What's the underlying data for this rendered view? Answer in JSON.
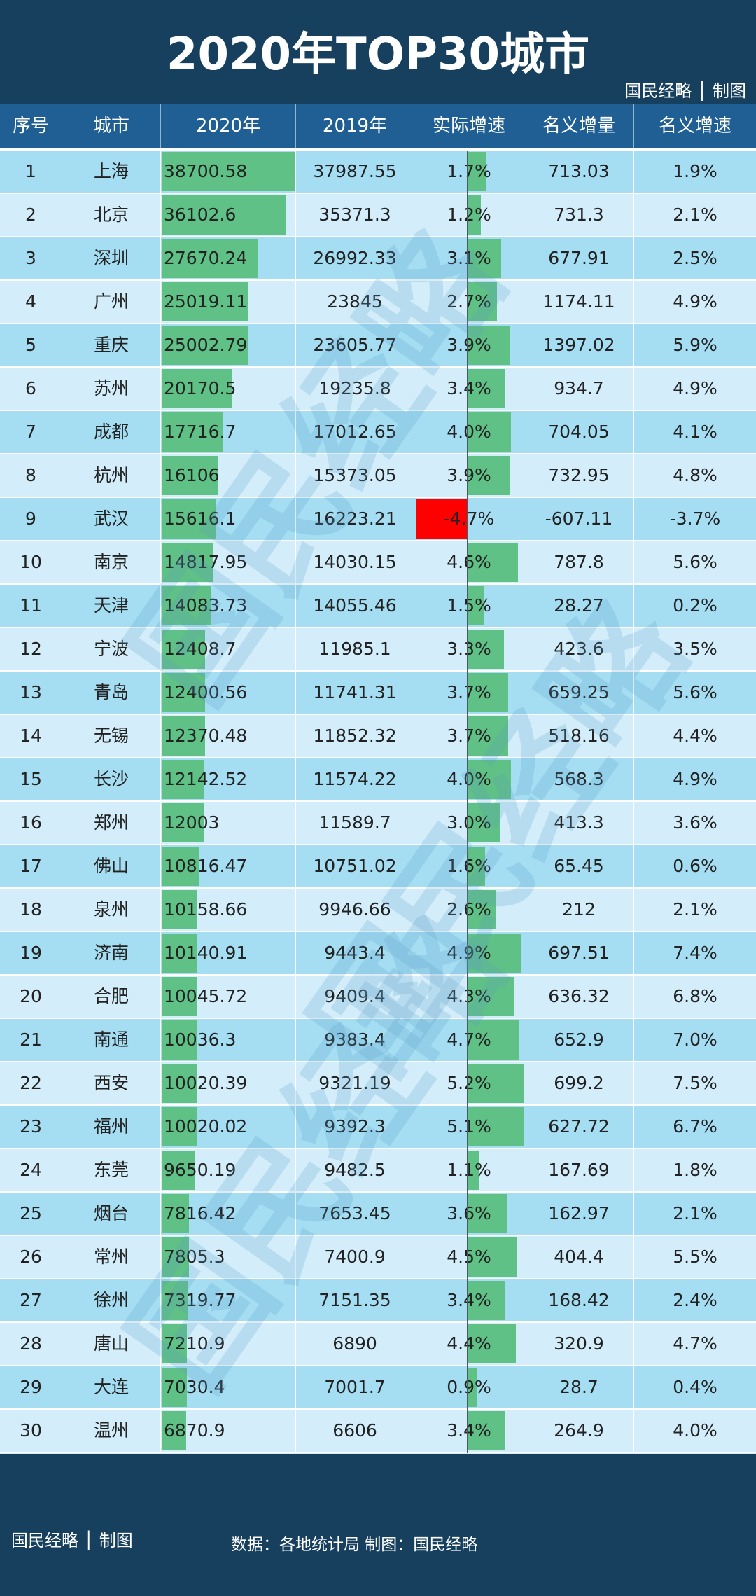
{
  "header": {
    "title": "2020年TOP30城市",
    "brand": "国民经略 │ 制图"
  },
  "columns": [
    "序号",
    "城市",
    "2020年",
    "2019年",
    "实际增速",
    "名义增量",
    "名义增速"
  ],
  "footer": {
    "brand": "国民经略 │ 制图",
    "source": "数据：各地统计局  制图：国民经略"
  },
  "watermark": "国民经略",
  "colors": {
    "title_bg": "#17405f",
    "header_bg": "#1f5f93",
    "row_odd": "#a5ddf2",
    "row_even": "#d3eefa",
    "bar_positive": "#5fc185",
    "bar_negative": "#ff0000"
  },
  "chart_data": {
    "type": "table",
    "title": "2020年TOP30城市",
    "columns": [
      "序号",
      "城市",
      "2020年",
      "2019年",
      "实际增速",
      "名义增量",
      "名义增速"
    ],
    "bar_columns": [
      "2020年",
      "实际增速"
    ],
    "rows": [
      {
        "rank": "1",
        "city": "上海",
        "y2020": "38700.58",
        "y2019": "37987.55",
        "real_growth": "1.7%",
        "nominal_increase": "713.03",
        "nominal_growth": "1.9%",
        "gdp": 38700.58,
        "rg": 1.7
      },
      {
        "rank": "2",
        "city": "北京",
        "y2020": "36102.6",
        "y2019": "35371.3",
        "real_growth": "1.2%",
        "nominal_increase": "731.3",
        "nominal_growth": "2.1%",
        "gdp": 36102.6,
        "rg": 1.2
      },
      {
        "rank": "3",
        "city": "深圳",
        "y2020": "27670.24",
        "y2019": "26992.33",
        "real_growth": "3.1%",
        "nominal_increase": "677.91",
        "nominal_growth": "2.5%",
        "gdp": 27670.24,
        "rg": 3.1
      },
      {
        "rank": "4",
        "city": "广州",
        "y2020": "25019.11",
        "y2019": "23845",
        "real_growth": "2.7%",
        "nominal_increase": "1174.11",
        "nominal_growth": "4.9%",
        "gdp": 25019.11,
        "rg": 2.7
      },
      {
        "rank": "5",
        "city": "重庆",
        "y2020": "25002.79",
        "y2019": "23605.77",
        "real_growth": "3.9%",
        "nominal_increase": "1397.02",
        "nominal_growth": "5.9%",
        "gdp": 25002.79,
        "rg": 3.9
      },
      {
        "rank": "6",
        "city": "苏州",
        "y2020": "20170.5",
        "y2019": "19235.8",
        "real_growth": "3.4%",
        "nominal_increase": "934.7",
        "nominal_growth": "4.9%",
        "gdp": 20170.5,
        "rg": 3.4
      },
      {
        "rank": "7",
        "city": "成都",
        "y2020": "17716.7",
        "y2019": "17012.65",
        "real_growth": "4.0%",
        "nominal_increase": "704.05",
        "nominal_growth": "4.1%",
        "gdp": 17716.7,
        "rg": 4.0
      },
      {
        "rank": "8",
        "city": "杭州",
        "y2020": "16106",
        "y2019": "15373.05",
        "real_growth": "3.9%",
        "nominal_increase": "732.95",
        "nominal_growth": "4.8%",
        "gdp": 16106,
        "rg": 3.9
      },
      {
        "rank": "9",
        "city": "武汉",
        "y2020": "15616.1",
        "y2019": "16223.21",
        "real_growth": "-4.7%",
        "nominal_increase": "-607.11",
        "nominal_growth": "-3.7%",
        "gdp": 15616.1,
        "rg": -4.7
      },
      {
        "rank": "10",
        "city": "南京",
        "y2020": "14817.95",
        "y2019": "14030.15",
        "real_growth": "4.6%",
        "nominal_increase": "787.8",
        "nominal_growth": "5.6%",
        "gdp": 14817.95,
        "rg": 4.6
      },
      {
        "rank": "11",
        "city": "天津",
        "y2020": "14083.73",
        "y2019": "14055.46",
        "real_growth": "1.5%",
        "nominal_increase": "28.27",
        "nominal_growth": "0.2%",
        "gdp": 14083.73,
        "rg": 1.5
      },
      {
        "rank": "12",
        "city": "宁波",
        "y2020": "12408.7",
        "y2019": "11985.1",
        "real_growth": "3.3%",
        "nominal_increase": "423.6",
        "nominal_growth": "3.5%",
        "gdp": 12408.7,
        "rg": 3.3
      },
      {
        "rank": "13",
        "city": "青岛",
        "y2020": "12400.56",
        "y2019": "11741.31",
        "real_growth": "3.7%",
        "nominal_increase": "659.25",
        "nominal_growth": "5.6%",
        "gdp": 12400.56,
        "rg": 3.7
      },
      {
        "rank": "14",
        "city": "无锡",
        "y2020": "12370.48",
        "y2019": "11852.32",
        "real_growth": "3.7%",
        "nominal_increase": "518.16",
        "nominal_growth": "4.4%",
        "gdp": 12370.48,
        "rg": 3.7
      },
      {
        "rank": "15",
        "city": "长沙",
        "y2020": "12142.52",
        "y2019": "11574.22",
        "real_growth": "4.0%",
        "nominal_increase": "568.3",
        "nominal_growth": "4.9%",
        "gdp": 12142.52,
        "rg": 4.0
      },
      {
        "rank": "16",
        "city": "郑州",
        "y2020": "12003",
        "y2019": "11589.7",
        "real_growth": "3.0%",
        "nominal_increase": "413.3",
        "nominal_growth": "3.6%",
        "gdp": 12003,
        "rg": 3.0
      },
      {
        "rank": "17",
        "city": "佛山",
        "y2020": "10816.47",
        "y2019": "10751.02",
        "real_growth": "1.6%",
        "nominal_increase": "65.45",
        "nominal_growth": "0.6%",
        "gdp": 10816.47,
        "rg": 1.6
      },
      {
        "rank": "18",
        "city": "泉州",
        "y2020": "10158.66",
        "y2019": "9946.66",
        "real_growth": "2.6%",
        "nominal_increase": "212",
        "nominal_growth": "2.1%",
        "gdp": 10158.66,
        "rg": 2.6
      },
      {
        "rank": "19",
        "city": "济南",
        "y2020": "10140.91",
        "y2019": "9443.4",
        "real_growth": "4.9%",
        "nominal_increase": "697.51",
        "nominal_growth": "7.4%",
        "gdp": 10140.91,
        "rg": 4.9
      },
      {
        "rank": "20",
        "city": "合肥",
        "y2020": "10045.72",
        "y2019": "9409.4",
        "real_growth": "4.3%",
        "nominal_increase": "636.32",
        "nominal_growth": "6.8%",
        "gdp": 10045.72,
        "rg": 4.3
      },
      {
        "rank": "21",
        "city": "南通",
        "y2020": "10036.3",
        "y2019": "9383.4",
        "real_growth": "4.7%",
        "nominal_increase": "652.9",
        "nominal_growth": "7.0%",
        "gdp": 10036.3,
        "rg": 4.7
      },
      {
        "rank": "22",
        "city": "西安",
        "y2020": "10020.39",
        "y2019": "9321.19",
        "real_growth": "5.2%",
        "nominal_increase": "699.2",
        "nominal_growth": "7.5%",
        "gdp": 10020.39,
        "rg": 5.2
      },
      {
        "rank": "23",
        "city": "福州",
        "y2020": "10020.02",
        "y2019": "9392.3",
        "real_growth": "5.1%",
        "nominal_increase": "627.72",
        "nominal_growth": "6.7%",
        "gdp": 10020.02,
        "rg": 5.1
      },
      {
        "rank": "24",
        "city": "东莞",
        "y2020": "9650.19",
        "y2019": "9482.5",
        "real_growth": "1.1%",
        "nominal_increase": "167.69",
        "nominal_growth": "1.8%",
        "gdp": 9650.19,
        "rg": 1.1
      },
      {
        "rank": "25",
        "city": "烟台",
        "y2020": "7816.42",
        "y2019": "7653.45",
        "real_growth": "3.6%",
        "nominal_increase": "162.97",
        "nominal_growth": "2.1%",
        "gdp": 7816.42,
        "rg": 3.6
      },
      {
        "rank": "26",
        "city": "常州",
        "y2020": "7805.3",
        "y2019": "7400.9",
        "real_growth": "4.5%",
        "nominal_increase": "404.4",
        "nominal_growth": "5.5%",
        "gdp": 7805.3,
        "rg": 4.5
      },
      {
        "rank": "27",
        "city": "徐州",
        "y2020": "7319.77",
        "y2019": "7151.35",
        "real_growth": "3.4%",
        "nominal_increase": "168.42",
        "nominal_growth": "2.4%",
        "gdp": 7319.77,
        "rg": 3.4
      },
      {
        "rank": "28",
        "city": "唐山",
        "y2020": "7210.9",
        "y2019": "6890",
        "real_growth": "4.4%",
        "nominal_increase": "320.9",
        "nominal_growth": "4.7%",
        "gdp": 7210.9,
        "rg": 4.4
      },
      {
        "rank": "29",
        "city": "大连",
        "y2020": "7030.4",
        "y2019": "7001.7",
        "real_growth": "0.9%",
        "nominal_increase": "28.7",
        "nominal_growth": "0.4%",
        "gdp": 7030.4,
        "rg": 0.9
      },
      {
        "rank": "30",
        "city": "温州",
        "y2020": "6870.9",
        "y2019": "6606",
        "real_growth": "3.4%",
        "nominal_increase": "264.9",
        "nominal_growth": "4.0%",
        "gdp": 6870.9,
        "rg": 3.4
      }
    ]
  }
}
